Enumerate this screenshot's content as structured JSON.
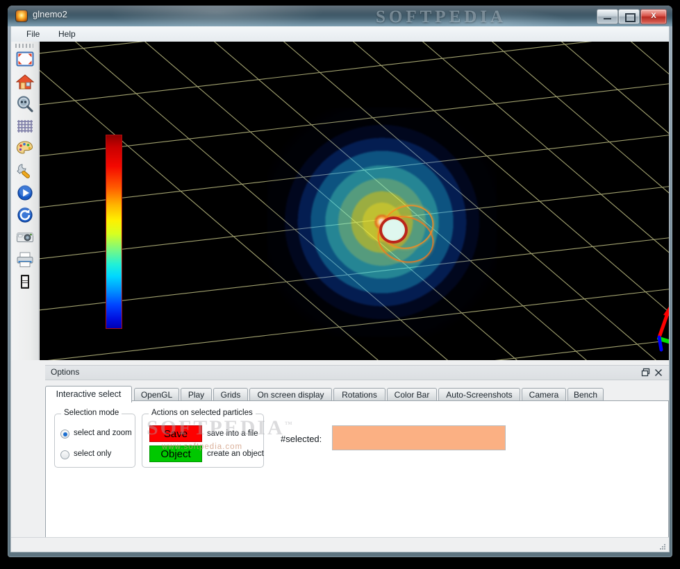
{
  "window": {
    "title": "glnemo2",
    "icon": "app-sphere-icon",
    "watermark_title": "SOFTPEDIA",
    "controls": {
      "minimize": "—",
      "maximize": "□",
      "close": "X"
    }
  },
  "menubar": {
    "items": [
      {
        "label": "File"
      },
      {
        "label": "Help"
      }
    ]
  },
  "toolbar": {
    "items": [
      {
        "name": "fullscreen-icon",
        "tip": "Full screen"
      },
      {
        "name": "home-icon",
        "tip": "Reset view"
      },
      {
        "name": "zoom-icon",
        "tip": "Zoom / look at"
      },
      {
        "name": "grid-icon",
        "tip": "Grids"
      },
      {
        "name": "palette-icon",
        "tip": "Colors"
      },
      {
        "name": "wrench-icon",
        "tip": "Options"
      },
      {
        "name": "play-icon",
        "tip": "Play"
      },
      {
        "name": "rotate-icon",
        "tip": "Auto rotate"
      },
      {
        "name": "camera-icon",
        "tip": "Screenshot"
      },
      {
        "name": "print-icon",
        "tip": "Print"
      },
      {
        "name": "film-icon",
        "tip": "Movie"
      }
    ]
  },
  "viewport": {
    "background_color": "#000000",
    "grid_color": "#b3b37a",
    "colorbar": {
      "name": "color-bar",
      "border_color": "#b01010",
      "stops": [
        "#8e0000",
        "#f40800",
        "#ffb400",
        "#fff000",
        "#7cf97e",
        "#00d8ff",
        "#0044ff",
        "#0000b4"
      ]
    },
    "axis_triad": {
      "x_color": "#ff0000",
      "y_color": "#00ff00",
      "z_color": "#0000ff"
    }
  },
  "dock": {
    "title": "Options",
    "float_icon": "float-icon",
    "close_icon": "close-icon"
  },
  "tabs": [
    {
      "label": "Interactive select",
      "active": true
    },
    {
      "label": "OpenGL",
      "active": false
    },
    {
      "label": "Play",
      "active": false
    },
    {
      "label": "Grids",
      "active": false
    },
    {
      "label": "On screen display",
      "active": false
    },
    {
      "label": "Rotations",
      "active": false
    },
    {
      "label": "Color Bar",
      "active": false
    },
    {
      "label": "Auto-Screenshots",
      "active": false
    },
    {
      "label": "Camera",
      "active": false
    },
    {
      "label": "Bench",
      "active": false
    }
  ],
  "interactive_select": {
    "selection_mode": {
      "title": "Selection mode",
      "options": [
        {
          "label": "select and zoom",
          "checked": true
        },
        {
          "label": "select only",
          "checked": false
        }
      ]
    },
    "actions": {
      "title": "Actions on selected particles",
      "buttons": [
        {
          "label": "Save",
          "description": "save into a file",
          "color": "#fe0000"
        },
        {
          "label": "Object",
          "description": "create an object",
          "color": "#00c800"
        }
      ]
    },
    "selected": {
      "label": "#selected:",
      "value": "",
      "placeholder": "",
      "background_color": "#fbb083"
    }
  },
  "watermark_panel": {
    "line1": "SOFTPEDIA",
    "trademark": "™",
    "line2": "www.softpedia.com"
  }
}
